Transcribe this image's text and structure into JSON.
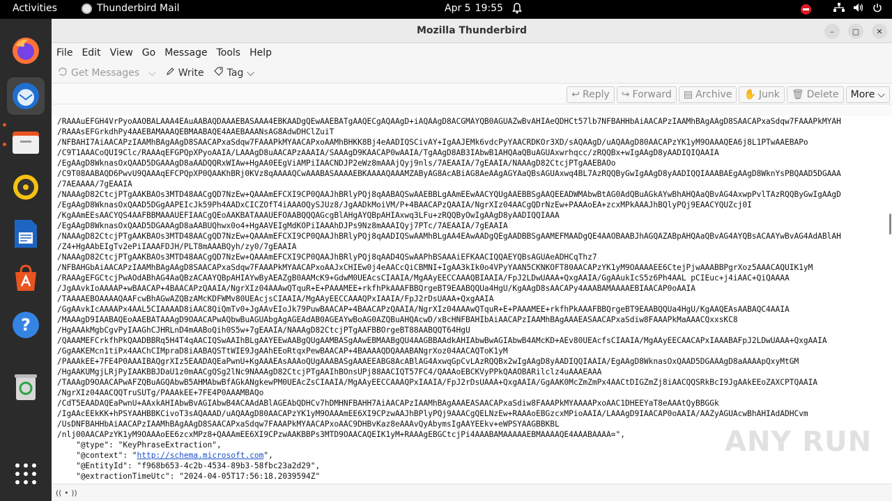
{
  "topbar": {
    "activities": "Activities",
    "app_name": "Thunderbird Mail",
    "date": "Apr 5",
    "time": "19:55"
  },
  "dock": {
    "items": [
      "firefox-icon",
      "thunderbird-icon",
      "files-icon",
      "rhythmbox-icon",
      "libreoffice-writer-icon",
      "app-center-icon",
      "help-icon",
      "trash-icon",
      "show-apps-icon"
    ]
  },
  "window": {
    "title": "Mozilla Thunderbird",
    "controls": {
      "minimize": "–",
      "maximize": "▢",
      "close": "✕"
    }
  },
  "menubar": {
    "items": [
      "File",
      "Edit",
      "View",
      "Go",
      "Message",
      "Tools",
      "Help"
    ]
  },
  "toolbar": {
    "get_messages": "Get Messages",
    "write": "Write",
    "tag": "Tag"
  },
  "message_actions": {
    "reply": "Reply",
    "forward": "Forward",
    "archive": "Archive",
    "junk": "Junk",
    "delete": "Delete",
    "more": "More"
  },
  "message_body": {
    "lines": [
      "/RAAAuEFGH4VrPyoAAOBALAAA4EAuAABAQDAAAEBASAAA4EBKAADgQEwAAEBATgAAQECgAQAAgD+iAQAAgD8ACGMAYQB0AGUAZwBvAHIAeQDHCt57lb7NFBAHHbAiAACAPzIAAMhBAgAAgD8SAACAPxaSdqw7FAAAPkMYAH",
      "/RAAAsEFGrkdhPy4AAEBAMAAAQEBMAABAQE4AAEBAAANsAG8AdwDHClZuiT",
      "/NFBAHI7AiAACAPzIAAMhBAgAAgD8SAACAPxaSdqw7FAAAPkMYAACAPxoAAMhBHKK8Bj4eAADIQSCivAY+IgAAJEMk6vdcPyYAACRDKOr3XD/sAQAAgD/uAQAAgD80AACAPzYK1yM9OAAAQEA6j8L1PTwAAEBAPo",
      "/C9T1AAACoQUI9Clc/RAAAqEFGPQpXPyoAAIA/LAAAgD8uAACAPzAAAIA/SAAAgD9KAACAP0wAAIA/TgAAgD8AB3IAbwB1AHQAaQBuAGUAxwrhqcc/zRQQBx+wIgAAgD8yAADIQIQAAIA",
      "/EgAAgD8WknasOxQAAD5DGAAAgD8aAADQQRxWIAw+HgAA0EEgViAMPiIAACNDJP2eWz8mAAAjQyj9nls/7AEAAIA/7gEAAIA/NAAAgD82CtcjPTgAAEBAOo",
      "/C9T08AABAQD6PwvU9QAAAqEFCPQpXP0QAAKhBRj0KVz8qAAAAQCwAAABASAAAAEBKAAAAQAAAMZAByAG8AcABiAG8AeAAgAGYAaQBsAGUAxwq4BL7AzRQQByGwIgAAgD8yAADIQQIAAABAEgAAgD8WknYsPBQAAD5DGAAA",
      "/7AEAAAA/7gEAAIA",
      "/NAAAgD82CtcjPTgAAKBAOs3MTD48AACgQD7NzEw+QAAAmEFCXI9CP0QAAJhBRlyPQj8qAABAQSwAAEBBLgAAmEEwAACYQUgAAEBBSgAAQEEADWMAbwBtAG0AdQBuAGkAYwBhAHQAaQBvAG4AxwpPvlTAzRQQByGwIgAAgD",
      "/EgAAgD8WknasOxQAAD5DGgAAPEIcJk59Ph4AADxCICZOfT4iAAAOQySJUz8/JgAADkMoiVM/P+4BAACAPzQAAIA/NgrXIz04AACgQDrNzEw+PAAAoEA+zcxMPkAAAJhBQlyPQj9EAACYQUZcj0I",
      "/KgAAmEEsAACYQS4AAFBBMAAAUEFIAACgQEoAAKBATAAAUEFOAABQQQAGcgBlAHgAYQBpAHIAxwq3LFu+zRQQByOwIgAAgD8yAADIQQIAAA",
      "/EgAAgD8WknasOxQAAD5DGAAAgD8aAABUQhwx0o4+HgAAVEIgMdKOPiIAAAhDJPs9Nz8mAAAIQyj7PTc/7AEAAIA/7gEAAIA",
      "/NAAAgD82CtcjPTgAAKBAOs3MTD48AACgQD7NzEw+QAAAmEFCXI9CP0QAAJhBRlyPQj8qAADIQSwAAMhBLgAA4EAwAADgQEgAADBBSgAAMEFMAADgQE4AAOBAABJhAGQAZABpAHQAaQBvAG4AYQBsACAAYwBvAG4AdABlAH",
      "/Z4+HgAAbEIgTv2ePiIAAAFDJH/PLT8mAAABQyh/zy0/7gEAAIA",
      "/NAAAgD82CtcjPTgAAKBAOs3MTD48AACgQD7NzEw+QAAAmEFCXI9CP0QAAJhBRlyPQj8qAAD4QSwAAPhBSAAAiEFKAACIQQAEYQBsAGUAeADHCqThz7",
      "/NFBAHGbAiAACAPzIAAMhBAgAAgD8SAACAPxaSdqw7FAAAPkMYAACAPxoAAJxCHIEw0j4eAACcQiCBMNI+IgAA3kIk0o4VPyYAAN5CKNKOFT80AACAPzYK1yM9OAAAAEE6CtejPjwAAABBPgrXoz5AAACAQUIK1yM",
      "/RAAAgEFGCtcjPwAOdABhAG4AaQBzACAAYQBpAHIAYwByAEAZgB0AAMcK9+GdwM0UEAcsCIAAIA/MgAAyEECCAAAQBIAAIA/FpJ2LDwUAAA+QxgAAIA/GgAAukIcS5z6Ph4AAL pCIEuc+j4iAAC+QiQAAAA",
      "/JgAAvkIoAAAAP+wBAACAP+4BAACAPzQAAIA/NgrXIz04AAAwQTquR+E+PAAAMEE+rkfhPkAAAFBBQrgeBT9EAABQQUa4HgU/KgAAgD8sAACAPy4AAABAMAAAAEBIAACAP0oAAIA",
      "/TAAAAEBOAAAAQAAFcwBhAGwAZQBzAMcKDFWMv80UEAcjsCIAAIA/MgAAyEECCAAAQPxIAAIA/FpJ2rDsUAAA+QxgAAIA",
      "/GgAAvkIcAAAAPx4AAL5CIAAAAD8iAAC8QiQmTv0+JgAAvEIoJk79PuwBAACAP+4BAACAPzQAAIA/NgrXIz04AAAwQTquR+E+PAAAMEE+rkfhPkAAAFBBQrgeBT9EAABQQUa4HgU/KgAAQEAsAABAQC4AAIA",
      "/MAAAgD9IAABAQEoAAEBATAAAgD9OAACAPwAQbwBuAGUAbgAgAGEAdAB0AGEAYwBoAG0AZQBuAHQAcwD/xBcHNFBAHIbAiAACAPzIAAMhBAgAAAEASAACAPxaSdiw8FAAAPkMaAAACQxxsKC8",
      "/HgAAAkMgbCgvPyIAAGhCJHRLnD4mAABoQih0S5w+7gEAAIA/NAAAgD82CtcjPTgAAFBBOrgeBT88AABQQT64HgU",
      "/QAAAMEFCrkfhPkQAADBBRq5H4T4qAACIQSwAAIhBLgAAYEEwAABgQUgAAMBASgAAwEBMAABgQU4AAGBBAAdkAHIAbwBwAGIAbwB4AMcKD+AEv80UEAcfsCIAAIA/MgAAyEECAACAPxIAAABAFpJ2LDwUAAA+QxgAAIA",
      "/GgAAKEMcn1tiPx4AAChCIMpraD8iAABAQSTtWIE9JgAAhEEoRtqxPewBAACAP+4BAAAAQDQAAABANgrXoz04AACAQToK1yM",
      "/PAAAkEE+7FE4P0AAAIBAQgrXIz5EAADAQEaPwnU+KgAAAEAsAAAoQUgAAABASgAAAEEABG8AcABlAG4AxwqGpCvLAzRQQBx2wIgAAgD8yAADIQQIAAIA/EgAAgD8WknasOxQAAD5DGAAAgD8aAAAApQxyMtGM",
      "/HgAAKUMgjLRjPyIAAKBBJDaU1z0mAACgQSg2lNc9NAAAgD82CtcjPTgAAIhBOnsUPj88AACIQT57FC4/QAAAoEBCKVyPPkQAAOBARilclz4uAAAEAAA",
      "/TAAAgD9OAACAPwAFZQBuAGQAbwB5AHMAbwBfAGkANgkewPM0UEAcZsCIAAIA/MgAAyEECCAAAQPxIAAIA/FpJ2rDsUAAA+QxgAAIA/GgAAK0McZmZmPx4AACtDIGZmZj8iAACQQSRkBcI9JgAAkEEoZAXCPTQAAIA",
      "/NgrXIz04AACQQTruSUTg/PAAAkEE+7FE4P0AAAMBAQo",
      "/CdT5EAADAQEaPwnU+AAxkAHIAbwBvAGIAbwB4ACAAdABlAGEAbQDHCv7hDMHNFBAHH7AiAACAPzIAAMhBAgAAAEASAACAPxaSdiw8FAAAPkMYAAAAPxoAAC1DHEEYaT8eAAAtQyBBGGk",
      "/IgAAcEEkKK+hPSYAAHBBKCivoT3sAQAAAD/uAQAAgD80AACAPzYK1yM9OAAAmEE6XI9CPzwAAJhBPlyPQj9AAACgQELNzEw+RAAAoEBGzcxMPioAAIA/LAAAgD9IAACAP0oAAIA/AAZyAGUAcwBhAHIAdADHCvm",
      "/UsDNFBAHHbAiAACAPzIAAMhBAgAAgD8SAACAPxaSdqw7FAAAPkMYAACAPxoAAC9DHBvKaz8eAAAvQyAbymsIgAAYEEkv+eWPSYAAGBBKBL",
      "/nlj00AACAPzYK1yM9OAAAoEE6zcxMPz8+QAAAmEE6XI9CPzwAAKBBPs3MTD9OAACAQEIK1yM+RAAAgEBGCtcjPi4AAABAMAAAAAEBMAAAAQE4AAABAAAA=\","
    ],
    "json_lines": [
      {
        "indent": "    ",
        "key": "\"@type\"",
        "value": "\"KeyPhraseExtraction\","
      },
      {
        "indent": "    ",
        "key": "\"@context\"",
        "value_link": "http://schema.microsoft.com",
        "suffix": "\","
      },
      {
        "indent": "    ",
        "key": "\"@EntityId\"",
        "value": "\"f968b653-4c2b-4534-89b3-58fbc23a2d29\","
      },
      {
        "indent": "    ",
        "key": "\"@extractionTimeUtc\"",
        "value": "\"2024-04-05T17:56:18.2039594Z\""
      }
    ]
  },
  "statusbar": {
    "icon": "(( • ))"
  },
  "watermark": "ANY RUN"
}
